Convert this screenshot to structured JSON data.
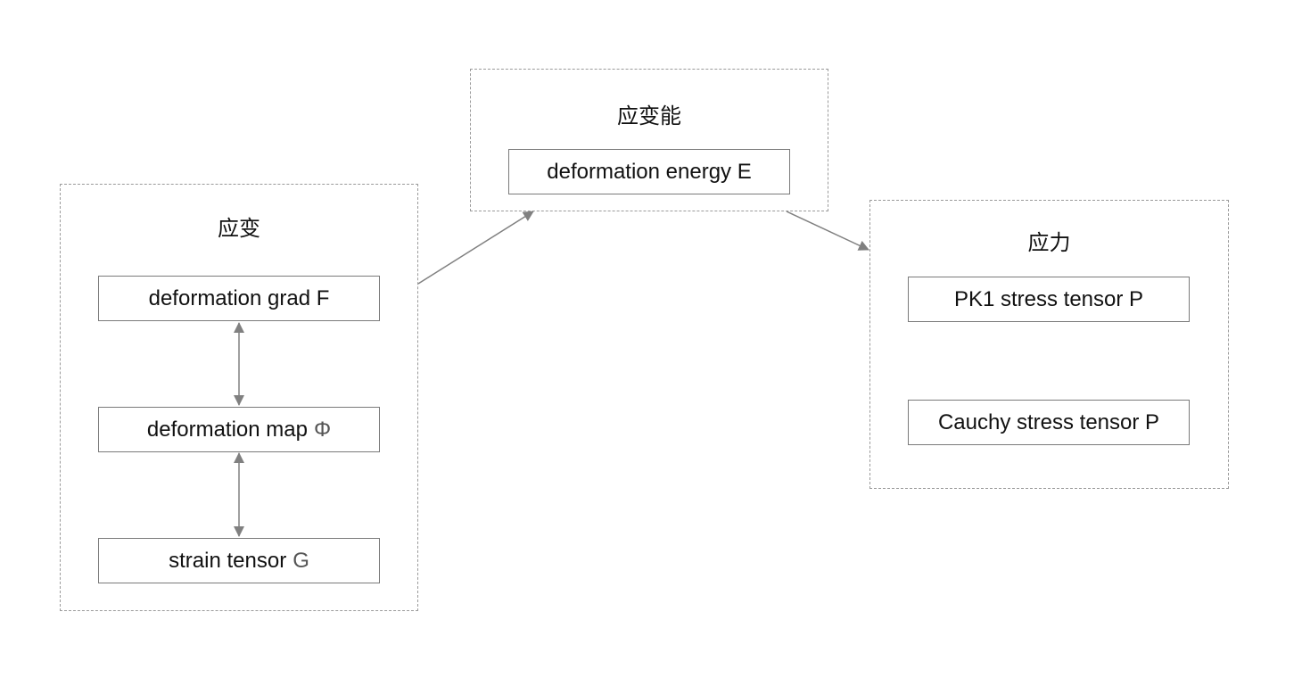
{
  "groups": {
    "strain": {
      "title": "应变"
    },
    "energy": {
      "title": "应变能"
    },
    "stress": {
      "title": "应力"
    }
  },
  "nodes": {
    "deformation_grad": "deformation grad F",
    "deformation_map": {
      "label": "deformation map",
      "symbol": "Φ"
    },
    "strain_tensor": {
      "label": "strain tensor",
      "symbol": "G"
    },
    "deformation_energy": "deformation energy E",
    "pk1_stress": "PK1 stress tensor P",
    "cauchy_stress": "Cauchy stress tensor P"
  },
  "edges": [
    {
      "from": "deformation_grad",
      "to": "deformation_map",
      "type": "bidirectional"
    },
    {
      "from": "deformation_map",
      "to": "strain_tensor",
      "type": "bidirectional"
    },
    {
      "from": "strain",
      "to": "energy",
      "type": "directed"
    },
    {
      "from": "energy",
      "to": "stress",
      "type": "directed"
    }
  ],
  "colors": {
    "border": "#9a9a9a",
    "node_border": "#7a7a7a",
    "edge": "#808080",
    "text": "#111111"
  }
}
